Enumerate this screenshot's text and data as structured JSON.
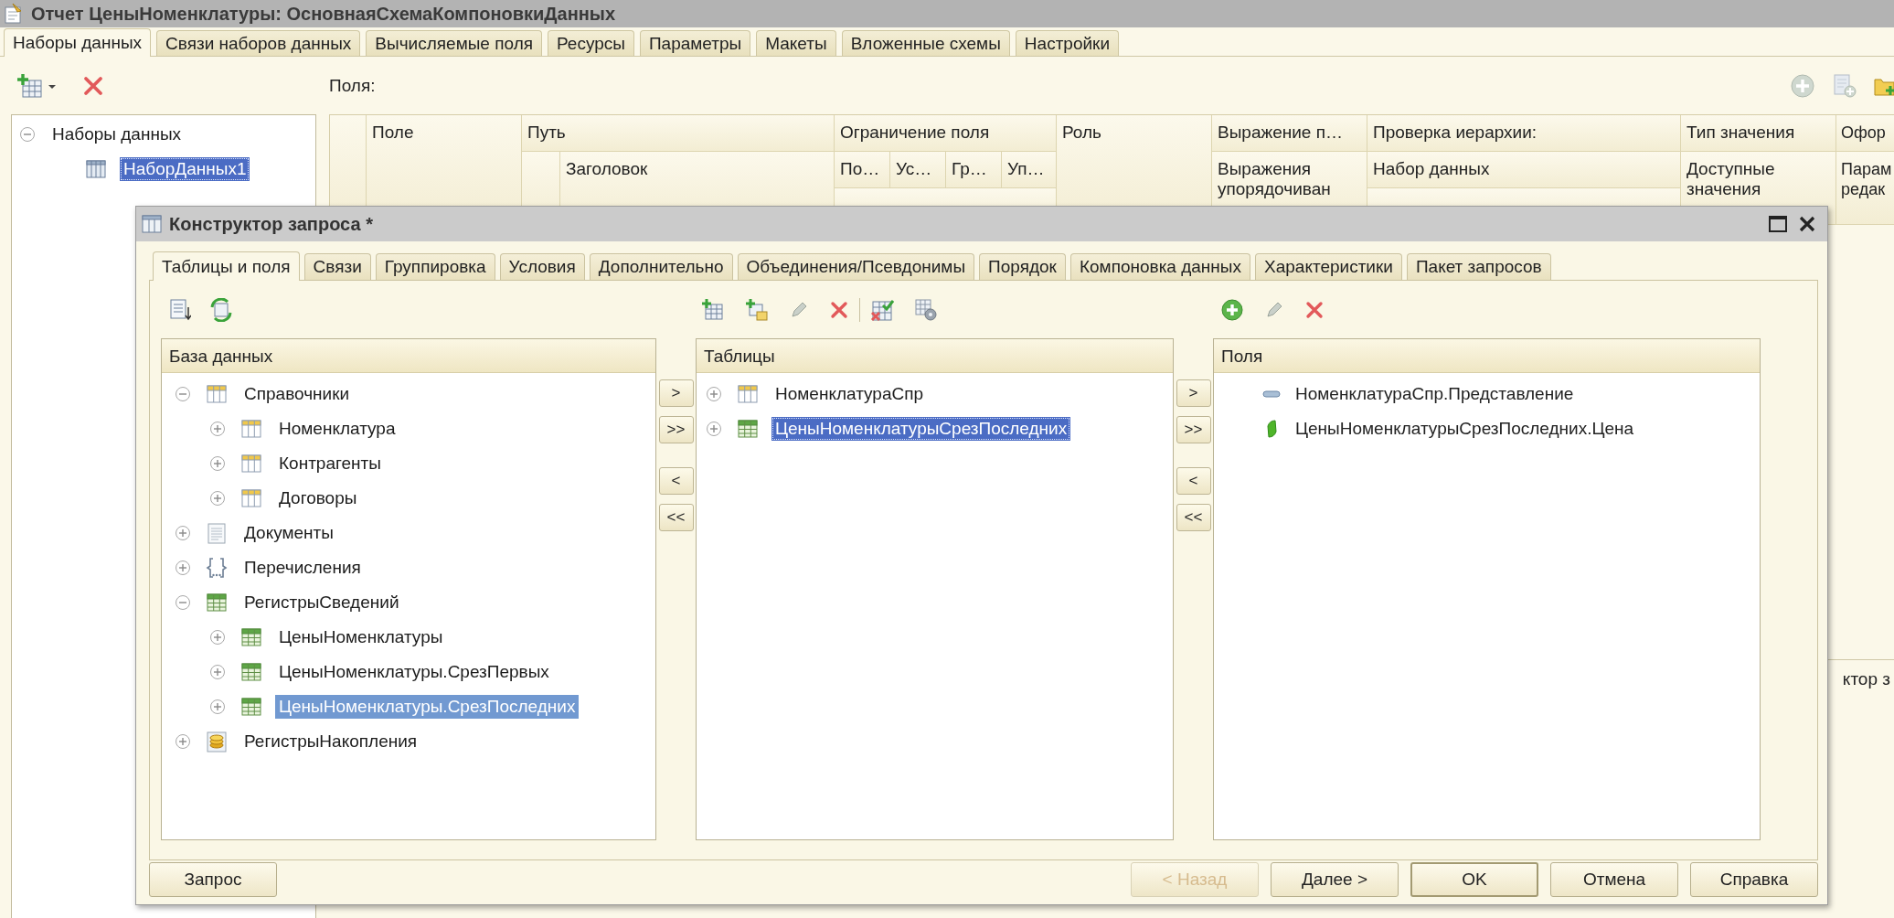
{
  "window": {
    "title": "Отчет ЦеныНоменклатуры: ОсновнаяСхемаКомпоновкиДанных"
  },
  "tabs": [
    {
      "label": "Наборы данных",
      "selected": true
    },
    {
      "label": "Связи наборов данных",
      "selected": false
    },
    {
      "label": "Вычисляемые поля",
      "selected": false
    },
    {
      "label": "Ресурсы",
      "selected": false
    },
    {
      "label": "Параметры",
      "selected": false
    },
    {
      "label": "Макеты",
      "selected": false
    },
    {
      "label": "Вложенные схемы",
      "selected": false
    },
    {
      "label": "Настройки",
      "selected": false
    }
  ],
  "data_sets": {
    "tree": [
      {
        "label": "Наборы данных",
        "expanded": true,
        "children": [
          {
            "label": "НаборДанных1",
            "kind": "dataset",
            "selected": true
          }
        ]
      }
    ]
  },
  "fields": {
    "label": "Поля:",
    "header_top": [
      "Поле",
      "Путь",
      "Ограничение поля",
      "Роль",
      "Выражение п…",
      "Проверка иерархии:",
      "Тип значения",
      "Офор"
    ],
    "header_second": [
      "Заголовок",
      "По…",
      "Ус…",
      "Гр…",
      "Уп…",
      "Выражения\nупорядочиван",
      "Набор данных",
      "Доступные\nзначения",
      "Парам\nредак"
    ]
  },
  "lower_panel": {
    "text": "ктор з"
  },
  "query_builder": {
    "title": "Конструктор запроса *",
    "tabs": [
      {
        "label": "Таблицы и поля",
        "selected": true
      },
      {
        "label": "Связи",
        "selected": false
      },
      {
        "label": "Группировка",
        "selected": false
      },
      {
        "label": "Условия",
        "selected": false
      },
      {
        "label": "Дополнительно",
        "selected": false
      },
      {
        "label": "Объединения/Псевдонимы",
        "selected": false
      },
      {
        "label": "Порядок",
        "selected": false
      },
      {
        "label": "Компоновка данных",
        "selected": false
      },
      {
        "label": "Характеристики",
        "selected": false
      },
      {
        "label": "Пакет запросов",
        "selected": false
      }
    ],
    "database": {
      "header": "База данных",
      "focused": false,
      "tree": [
        {
          "label": "Справочники",
          "kind": "catalog",
          "expanded": true,
          "selected": false,
          "children": [
            {
              "label": "Номенклатура",
              "kind": "catalog",
              "expanded": false,
              "selected": false
            },
            {
              "label": "Контрагенты",
              "kind": "catalog",
              "expanded": false,
              "selected": false
            },
            {
              "label": "Договоры",
              "kind": "catalog",
              "expanded": false,
              "selected": false
            }
          ]
        },
        {
          "label": "Документы",
          "kind": "document",
          "expanded": false,
          "selected": false
        },
        {
          "label": "Перечисления",
          "kind": "enum",
          "expanded": false,
          "selected": false
        },
        {
          "label": "РегистрыСведений",
          "kind": "register",
          "expanded": true,
          "selected": false,
          "children": [
            {
              "label": "ЦеныНоменклатуры",
              "kind": "register",
              "expanded": false,
              "selected": false
            },
            {
              "label": "ЦеныНоменклатуры.СрезПервых",
              "kind": "register",
              "expanded": false,
              "selected": false
            },
            {
              "label": "ЦеныНоменклатуры.СрезПоследних",
              "kind": "register",
              "expanded": false,
              "selected": true
            }
          ]
        },
        {
          "label": "РегистрыНакопления",
          "kind": "accumulation",
          "expanded": false,
          "selected": false
        }
      ]
    },
    "move_buttons_left": [
      ">",
      ">>",
      "<",
      "<<"
    ],
    "tables": {
      "header": "Таблицы",
      "focused": true,
      "tree": [
        {
          "label": "НоменклатураСпр",
          "kind": "catalog",
          "expanded": false,
          "selected": false
        },
        {
          "label": "ЦеныНоменклатурыСрезПоследних",
          "kind": "register",
          "expanded": false,
          "selected": true
        }
      ]
    },
    "move_buttons_right": [
      ">",
      ">>",
      "<",
      "<<"
    ],
    "fields": {
      "header": "Поля",
      "items": [
        {
          "label": "НоменклатураСпр.Представление",
          "kind": "attribute"
        },
        {
          "label": "ЦеныНоменклатурыСрезПоследних.Цена",
          "kind": "resource"
        }
      ]
    },
    "buttons": [
      {
        "label": "Запрос",
        "disabled": false,
        "default": false
      },
      {
        "label": "< Назад",
        "disabled": true,
        "default": false
      },
      {
        "label": "Далее >",
        "disabled": false,
        "default": false
      },
      {
        "label": "OK",
        "disabled": false,
        "default": true
      },
      {
        "label": "Отмена",
        "disabled": false,
        "default": false
      },
      {
        "label": "Справка",
        "disabled": false,
        "default": false
      }
    ]
  }
}
